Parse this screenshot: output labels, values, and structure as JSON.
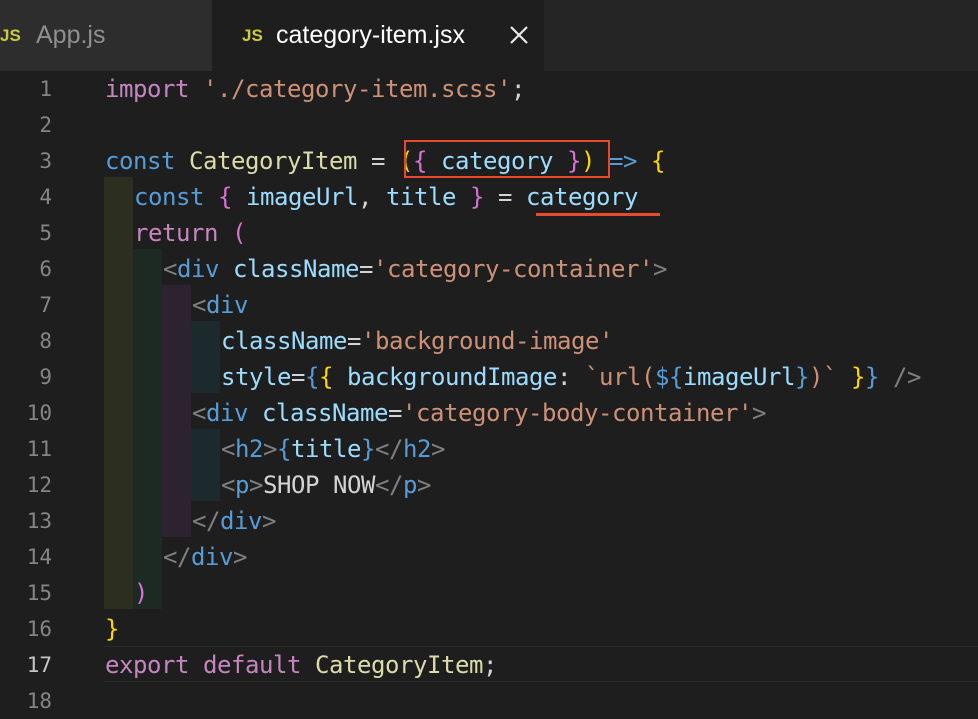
{
  "tabs": [
    {
      "icon": "JS",
      "label": "App.js",
      "active": false
    },
    {
      "icon": "JS",
      "label": "category-item.jsx",
      "active": true
    }
  ],
  "line_numbers": [
    "1",
    "2",
    "3",
    "4",
    "5",
    "6",
    "7",
    "8",
    "9",
    "10",
    "11",
    "12",
    "13",
    "14",
    "15",
    "16",
    "17",
    "18"
  ],
  "code": {
    "l1": [
      "import",
      " ",
      "'./category-item.scss'",
      ";"
    ],
    "l3": [
      "const",
      " ",
      "CategoryItem",
      " = ",
      "(",
      "{",
      " ",
      "category",
      " ",
      "}",
      ")",
      " ",
      "=>",
      " ",
      "{"
    ],
    "l4": [
      "const",
      " ",
      "{",
      " ",
      "imageUrl",
      ", ",
      "title",
      " ",
      "}",
      " = ",
      "category"
    ],
    "l5": [
      "return",
      " ",
      "("
    ],
    "l6": [
      "<",
      "div",
      " ",
      "className",
      "=",
      "'category-container'",
      ">"
    ],
    "l7": [
      "<",
      "div"
    ],
    "l8": [
      "className",
      "=",
      "'background-image'"
    ],
    "l9": [
      "style",
      "=",
      "{",
      "{",
      " ",
      "backgroundImage",
      ": ",
      "`url(",
      "${",
      "imageUrl",
      "}",
      ")`",
      " ",
      "}",
      "}",
      " ",
      "/>"
    ],
    "l10": [
      "<",
      "div",
      " ",
      "className",
      "=",
      "'category-body-container'",
      ">"
    ],
    "l11": [
      "<",
      "h2",
      ">",
      "{",
      "title",
      "}",
      "</",
      "h2",
      ">"
    ],
    "l12": [
      "<",
      "p",
      ">",
      "SHOP NOW",
      "</",
      "p",
      ">"
    ],
    "l13": [
      "</",
      "div",
      ">"
    ],
    "l14": [
      "</",
      "div",
      ">"
    ],
    "l15": [
      ")"
    ],
    "l16": [
      "}"
    ],
    "l17": [
      "export",
      " ",
      "default",
      " ",
      "CategoryItem",
      ";"
    ]
  },
  "colors": {
    "annotation": "#e84a2e",
    "keyword": "#569cd6",
    "control": "#c586c0",
    "string": "#ce9178",
    "variable": "#9cdcfe"
  }
}
